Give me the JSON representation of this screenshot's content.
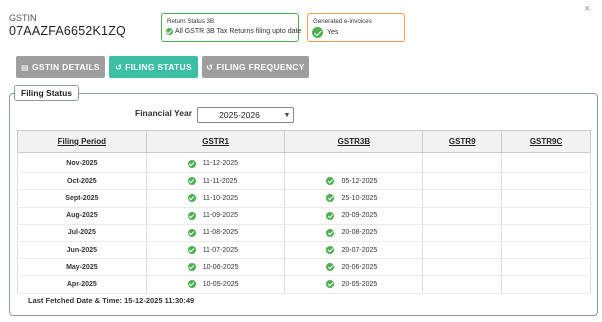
{
  "close_icon": "×",
  "header": {
    "gstin_label": "GSTIN",
    "gstin_value": "07AAZFA6652K1ZQ"
  },
  "return_status": {
    "title": "Return Status 3B",
    "text": "All GSTR 3B Tax Returns filing upto date",
    "color": "#4caf50"
  },
  "einvoice": {
    "title": "Generated e-invoices",
    "value": "Yes",
    "color": "#e8a24c"
  },
  "tabs": [
    {
      "label": "GSTIN DETAILS",
      "icon": "id-card-icon",
      "active": false
    },
    {
      "label": "FILING STATUS",
      "icon": "history-icon",
      "active": true
    },
    {
      "label": "FILING FREQUENCY",
      "icon": "history-icon",
      "active": false
    }
  ],
  "accent_color": "#3dbfa6",
  "panel": {
    "legend": "Filing Status",
    "fy_label": "Financial Year",
    "fy_value": "2025-2026"
  },
  "table": {
    "headers": [
      "Filing Period",
      "GSTR1",
      "GSTR3B",
      "GSTR9",
      "GSTR9C"
    ],
    "rows": [
      {
        "period": "Nov-2025",
        "gstr1": "11-12-2025",
        "gstr3b": ""
      },
      {
        "period": "Oct-2025",
        "gstr1": "11-11-2025",
        "gstr3b": "05-12-2025"
      },
      {
        "period": "Sept-2025",
        "gstr1": "11-10-2025",
        "gstr3b": "25-10-2025"
      },
      {
        "period": "Aug-2025",
        "gstr1": "11-09-2025",
        "gstr3b": "20-09-2025"
      },
      {
        "period": "Jul-2025",
        "gstr1": "11-08-2025",
        "gstr3b": "20-08-2025"
      },
      {
        "period": "Jun-2025",
        "gstr1": "11-07-2025",
        "gstr3b": "20-07-2025"
      },
      {
        "period": "May-2025",
        "gstr1": "10-06-2025",
        "gstr3b": "20-06-2025"
      },
      {
        "period": "Apr-2025",
        "gstr1": "10-05-2025",
        "gstr3b": "20-05-2025"
      }
    ]
  },
  "footer": {
    "last_fetched": "Last Fetched Date & Time: 15-12-2025 11:30:49"
  }
}
